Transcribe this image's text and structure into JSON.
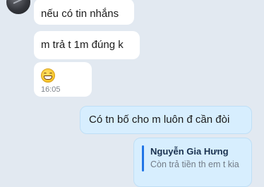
{
  "contact": {
    "avatar_icon": "avatar-photo-icon"
  },
  "messages": [
    {
      "direction": "incoming",
      "text": "nếu có tin nhắns"
    },
    {
      "direction": "incoming",
      "text": "m trả t 1m đúng k"
    },
    {
      "direction": "incoming",
      "emoji": "grinning-face-icon",
      "time": "16:05"
    },
    {
      "direction": "outgoing",
      "text": "Có tn bố cho m luôn đ cần đòi"
    },
    {
      "direction": "outgoing",
      "reply_quote": {
        "name": "Nguyễn Gia Hưng",
        "text": "Còn trả tiền th em t kia"
      }
    }
  ],
  "colors": {
    "background": "#e2e9f1",
    "incoming_bubble": "#ffffff",
    "outgoing_bubble": "#d7eefe",
    "quote_accent": "#1f74e6"
  }
}
